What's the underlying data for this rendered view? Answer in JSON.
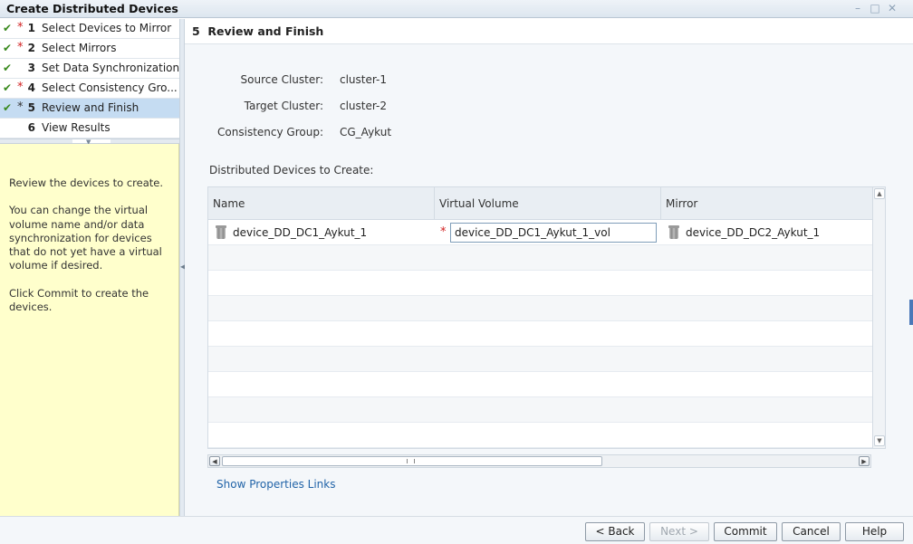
{
  "window": {
    "title": "Create Distributed Devices",
    "controls": [
      "minimize-icon",
      "maximize-icon",
      "close-icon"
    ]
  },
  "steps": [
    {
      "check": "✔",
      "required": "*",
      "number": "1",
      "label": "Select Devices to Mirror"
    },
    {
      "check": "✔",
      "required": "*",
      "number": "2",
      "label": "Select Mirrors"
    },
    {
      "check": "✔",
      "required": "",
      "number": "3",
      "label": "Set Data Synchronization"
    },
    {
      "check": "✔",
      "required": "*",
      "number": "4",
      "label": "Select Consistency Gro..."
    },
    {
      "check": "✔",
      "required": "*",
      "number": "5",
      "label": "Review and Finish"
    },
    {
      "check": "",
      "required": "",
      "number": "6",
      "label": "View Results"
    }
  ],
  "help": {
    "p1": "Review the devices to create.",
    "p2": "You can change the virtual volume name and/or data synchronization for devices that do not yet have a virtual volume if desired.",
    "p3": "Click Commit to create the devices."
  },
  "main": {
    "step_number": "5",
    "title": "Review and Finish",
    "source_cluster_label": "Source Cluster:",
    "source_cluster_value": "cluster-1",
    "target_cluster_label": "Target Cluster:",
    "target_cluster_value": "cluster-2",
    "consistency_group_label": "Consistency Group:",
    "consistency_group_value": "CG_Aykut",
    "table_title": "Distributed Devices to Create:",
    "show_properties_link": "Show Properties Links"
  },
  "table": {
    "columns": [
      "Name",
      "Virtual Volume",
      "Mirror"
    ],
    "rows": [
      {
        "name": "device_DD_DC1_Aykut_1",
        "virtual_volume": "device_DD_DC1_Aykut_1_vol",
        "mirror": "device_DD_DC2_Aykut_1",
        "required": "*"
      }
    ],
    "horizontal_scroll_fraction": 0.58
  },
  "footer": {
    "back": "< Back",
    "next": "Next >",
    "commit": "Commit",
    "cancel": "Cancel",
    "help": "Help"
  },
  "colors": {
    "selected_step": "#c5dcf2",
    "help_background": "#ffffcc",
    "check": "#3a8a1e",
    "required": "#d12020",
    "link": "#2264a8"
  }
}
